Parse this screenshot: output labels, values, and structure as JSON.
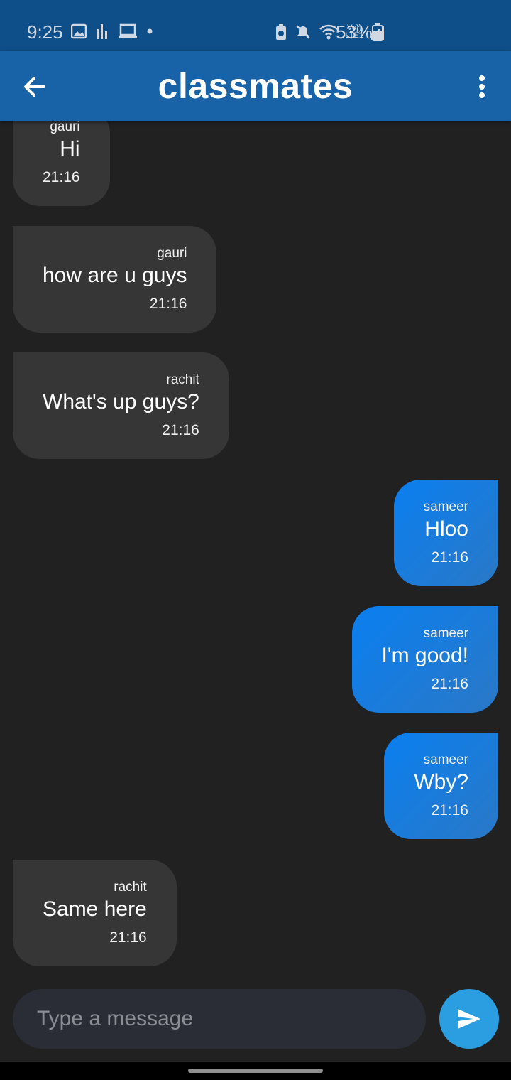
{
  "status_bar": {
    "time": "9:25",
    "battery": "53%",
    "icons": [
      "gallery-icon",
      "equalizer-icon",
      "laptop-icon",
      "dot-icon",
      "battery-saver-icon",
      "mute-icon",
      "wifi-icon",
      "volte-icon",
      "signal-icon",
      "battery-icon"
    ],
    "volte_label": "Vo))"
  },
  "app_bar": {
    "title": "classmates",
    "back_icon": "arrow-left-icon",
    "menu_icon": "more-vert-icon"
  },
  "messages": [
    {
      "sender": "gauri",
      "text": "Hi",
      "time": "21:16",
      "direction": "incoming"
    },
    {
      "sender": "gauri",
      "text": "how are u guys",
      "time": "21:16",
      "direction": "incoming"
    },
    {
      "sender": "rachit",
      "text": "What's up guys?",
      "time": "21:16",
      "direction": "incoming"
    },
    {
      "sender": "sameer",
      "text": "Hloo",
      "time": "21:16",
      "direction": "outgoing"
    },
    {
      "sender": "sameer",
      "text": "I'm good!",
      "time": "21:16",
      "direction": "outgoing"
    },
    {
      "sender": "sameer",
      "text": "Wby?",
      "time": "21:16",
      "direction": "outgoing"
    },
    {
      "sender": "rachit",
      "text": "Same here",
      "time": "21:16",
      "direction": "incoming"
    }
  ],
  "composer": {
    "placeholder": "Type a message",
    "value": "",
    "send_icon": "send-icon"
  },
  "colors": {
    "background": "#212121",
    "app_bar": "#1862a8",
    "status_bar": "#0e4f8a",
    "incoming_bubble": "#363636",
    "outgoing_bubble": "#0a7ff0",
    "send_button": "#2a9ee0"
  }
}
